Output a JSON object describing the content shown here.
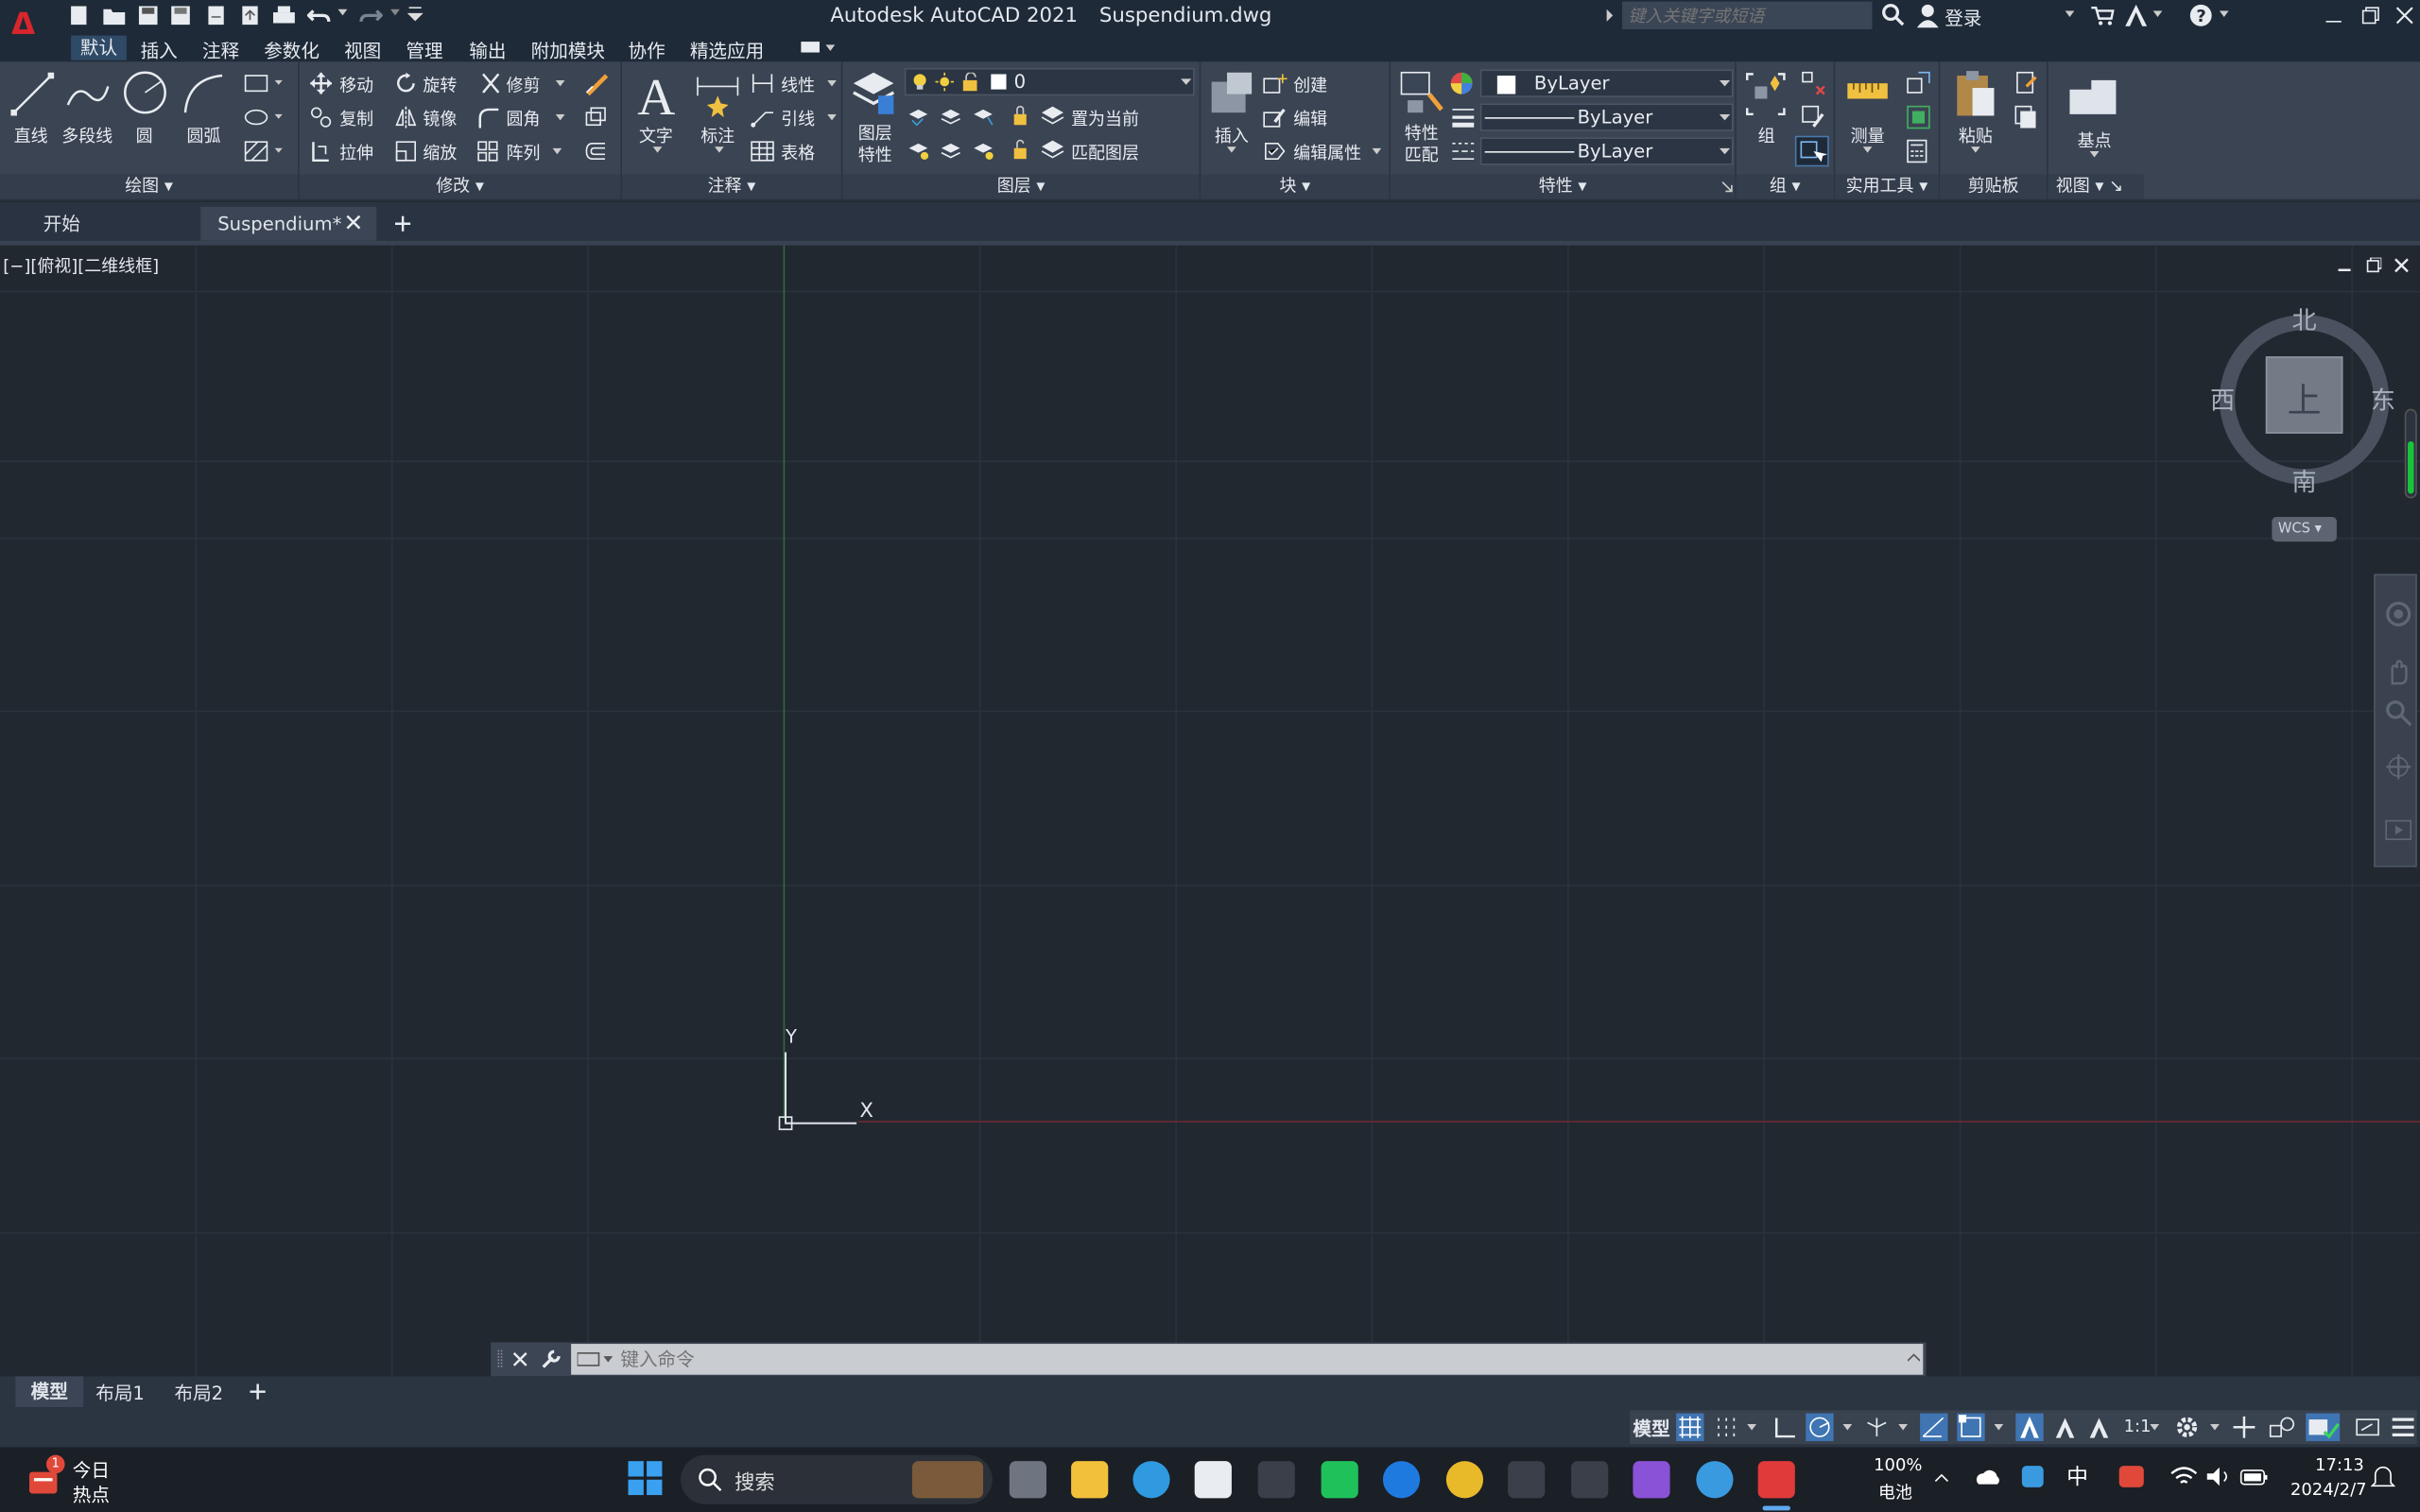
{
  "app": {
    "title": "Autodesk AutoCAD 2021",
    "filename": "Suspendium.dwg",
    "search_placeholder": "键入关键字或短语",
    "login": "登录"
  },
  "menu": [
    "默认",
    "插入",
    "注释",
    "参数化",
    "视图",
    "管理",
    "输出",
    "附加模块",
    "协作",
    "精选应用"
  ],
  "ribbon": {
    "draw": {
      "title": "绘图",
      "tools": [
        "直线",
        "多段线",
        "圆",
        "圆弧"
      ]
    },
    "modify": {
      "title": "修改",
      "tools": [
        "移动",
        "旋转",
        "修剪",
        "复制",
        "镜像",
        "圆角",
        "拉伸",
        "缩放",
        "阵列"
      ]
    },
    "annotation": {
      "title": "注释",
      "tools": [
        "文字",
        "标注",
        "线性",
        "引线",
        "表格"
      ]
    },
    "layers": {
      "title": "图层",
      "props_label": "图层特性",
      "current_layer": "0",
      "set_current": "置为当前",
      "match_layer": "匹配图层"
    },
    "block": {
      "title": "块",
      "insert": "插入",
      "create": "创建",
      "edit": "编辑",
      "edit_attr": "编辑属性"
    },
    "properties": {
      "title": "特性",
      "match": "特性匹配",
      "color": "ByLayer",
      "lineweight": "ByLayer",
      "linetype": "ByLayer"
    },
    "groups": {
      "title": "组",
      "group": "组"
    },
    "utilities": {
      "title": "实用工具",
      "measure": "测量"
    },
    "clipboard": {
      "title": "剪贴板",
      "paste": "粘贴"
    },
    "view": {
      "title": "视图",
      "base": "基点"
    }
  },
  "file_tabs": {
    "start": "开始",
    "active": "Suspendium*"
  },
  "viewport": {
    "label": "[−][俯视][二维线框]",
    "viewcube": {
      "north": "北",
      "south": "南",
      "east": "东",
      "west": "西",
      "top": "上",
      "wcs": "WCS"
    },
    "ucs": {
      "x": "X",
      "y": "Y"
    }
  },
  "command": {
    "placeholder": "键入命令"
  },
  "layout_tabs": [
    "模型",
    "布局1",
    "布局2"
  ],
  "status": {
    "model": "模型",
    "scale": "1:1"
  },
  "taskbar": {
    "widget_title": "今日",
    "widget_sub": "热点",
    "widget_badge": "1",
    "search": "搜索",
    "battery_pct": "100%",
    "battery_label": "电池",
    "ime": "中",
    "time": "17:13",
    "date": "2024/2/7"
  }
}
